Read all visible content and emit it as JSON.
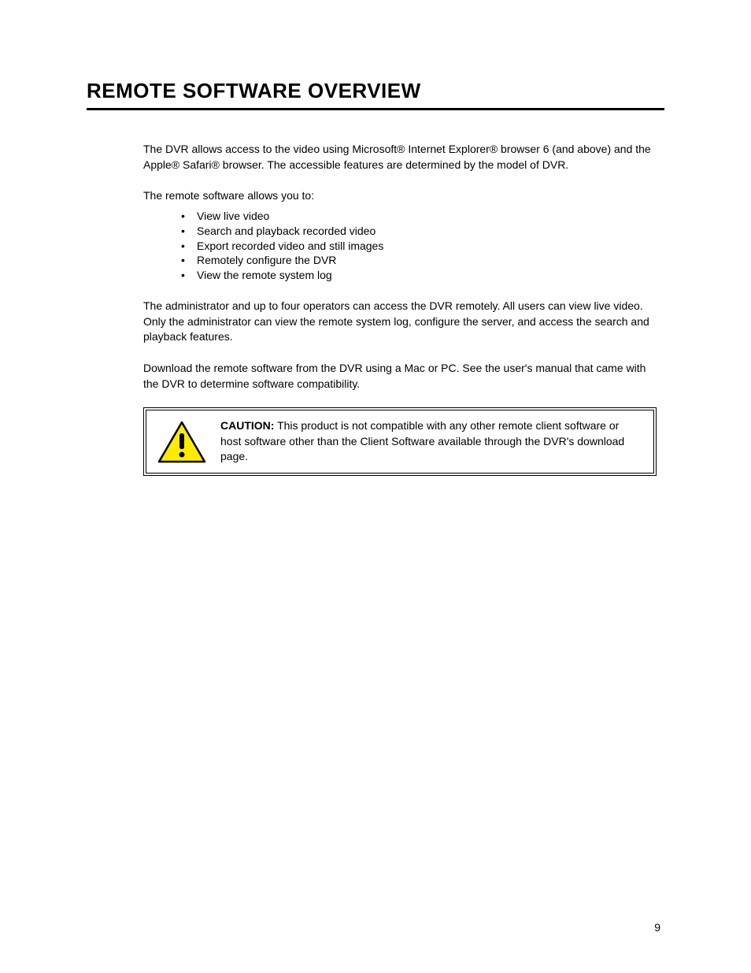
{
  "title": "REMOTE SOFTWARE OVERVIEW",
  "intro": "The DVR allows access to the video using Microsoft® Internet Explorer® browser 6 (and above) and the Apple® Safari® browser. The accessible features are determined by the model of DVR.",
  "features_intro": "The remote software allows you to:",
  "features": [
    "View live video",
    "Search and playback recorded video",
    "Export recorded video and still images",
    "Remotely configure the DVR",
    "View the remote system log"
  ],
  "admin_para": "The administrator and up to four operators can access the DVR remotely. All users can view live video. Only the administrator can view the remote system log, configure the server, and access the search and playback features.",
  "software_para": "Download the remote software from the DVR using a Mac or PC. See the user's manual that came with the DVR to determine software compatibility.",
  "caution_label": "CAUTION",
  "caution_text": "This product is not compatible with any other remote client software or host software other than the Client Software available through the DVR's download page.",
  "page_number": "9"
}
